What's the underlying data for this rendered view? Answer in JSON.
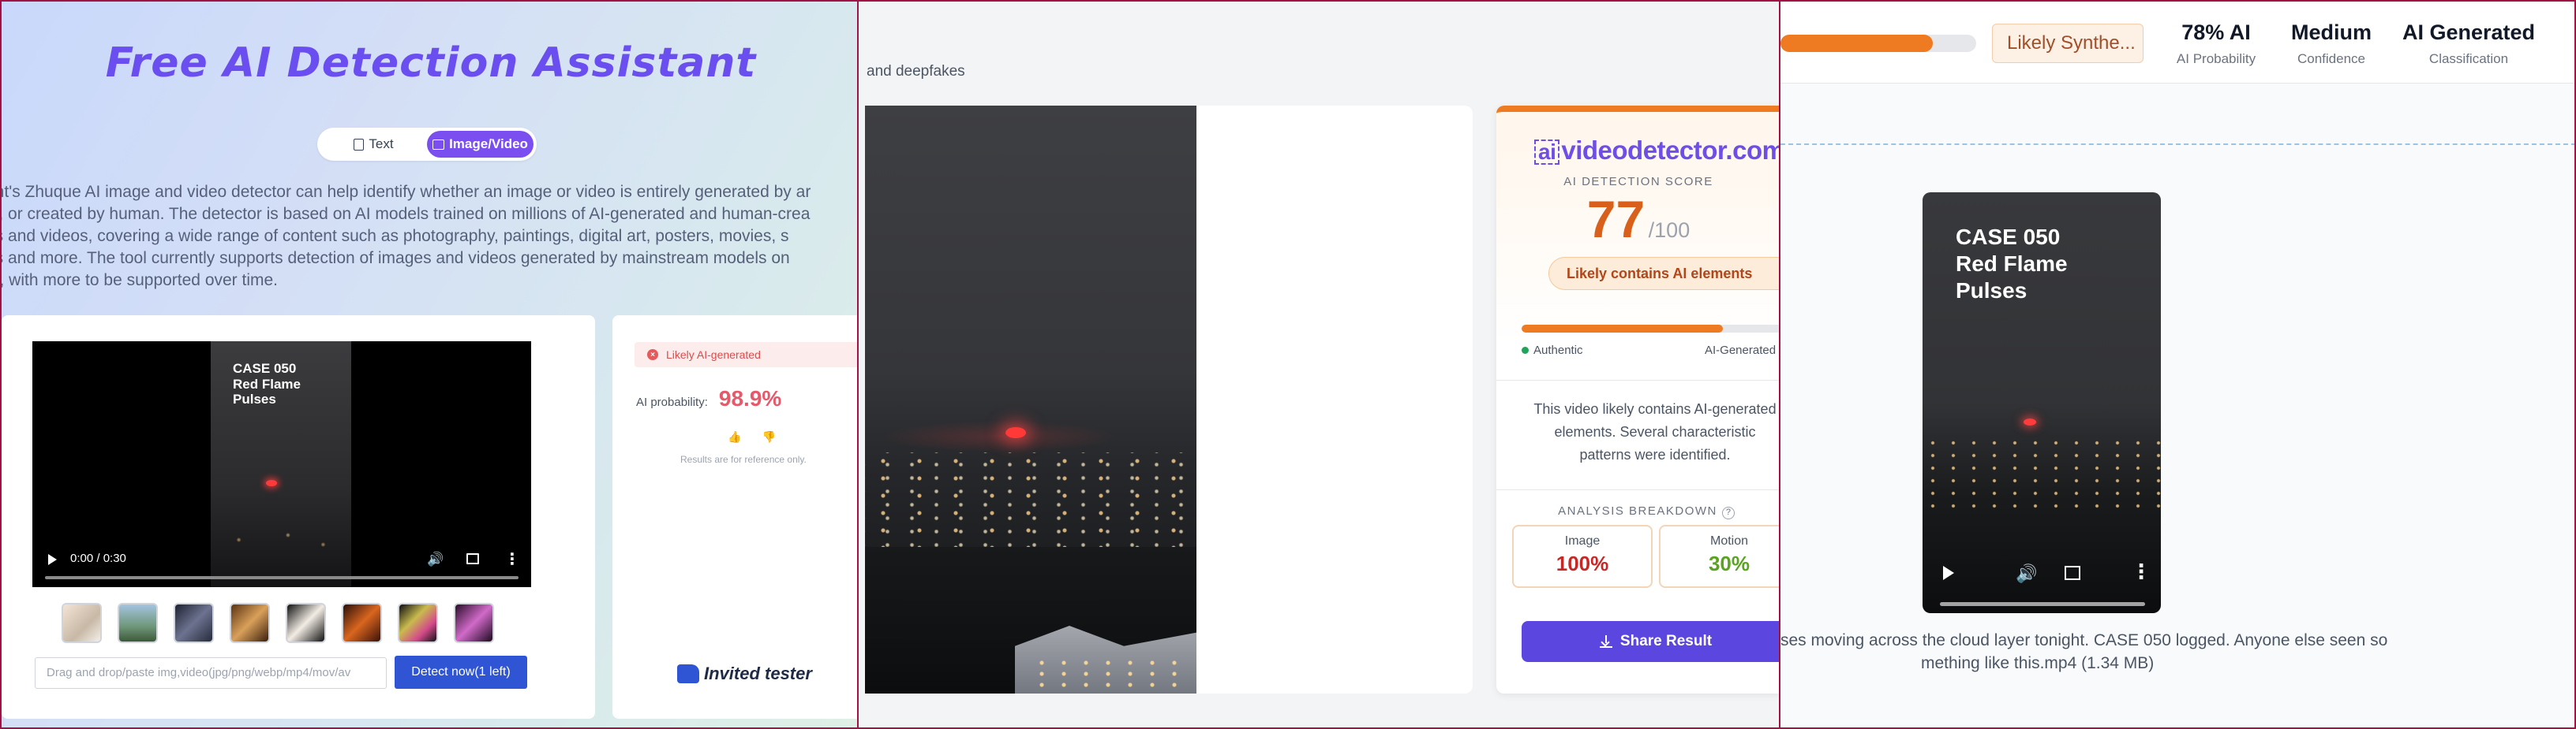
{
  "panel1": {
    "title": "Free AI Detection Assistant",
    "tabs": [
      {
        "label": "Text",
        "active": false
      },
      {
        "label": "Image/Video",
        "active": true
      }
    ],
    "description_lines": [
      "ent's Zhuque AI image and video detector can help identify whether an image or video is entirely generated by ar",
      "el, or created by human. The detector is based on AI models trained on millions of AI-generated and human-crea",
      "es and videos, covering a wide range of content such as photography, paintings, digital art, posters, movies, s",
      "os and more. The tool currently supports detection of images and videos generated by mainstream models on",
      "et, with more to be supported over time."
    ],
    "video": {
      "overlay_lines": [
        "CASE 050",
        "Red Flame",
        "Pulses"
      ],
      "time": "0:00 / 0:30"
    },
    "upload_placeholder": "Drag and drop/paste img,video(jpg/png/webp/mp4/mov/av",
    "detect_button": "Detect now(1 left)",
    "result": {
      "badge": "Likely AI-generated",
      "prob_label": "AI probability:",
      "prob_value": "98.9%",
      "note": "Results are for reference only."
    },
    "tester_label": "Invited tester",
    "colors": {
      "accent": "#7b4ef0",
      "detect": "#2f55d4",
      "prob": "#e5596b"
    }
  },
  "panel2": {
    "top_text": "and deepfakes",
    "brand": {
      "prefix": "ai",
      "name": "videodetector.com"
    },
    "score_label": "AI DETECTION SCORE",
    "score": "77",
    "score_max": "/100",
    "verdict": "Likely contains AI elements",
    "meter_fraction": 0.75,
    "meter_left": "Authentic",
    "meter_right": "AI-Generated",
    "summary_lines": [
      "This video likely contains AI-generated",
      "elements. Several characteristic",
      "patterns were identified."
    ],
    "breakdown_label": "ANALYSIS BREAKDOWN",
    "metrics": [
      {
        "label": "Image",
        "value": "100%",
        "color": "#c62828"
      },
      {
        "label": "Motion",
        "value": "30%",
        "color": "#5aa321"
      }
    ],
    "share_button": "Share Result",
    "colors": {
      "accent": "#ee7b22",
      "score": "#d9601a",
      "share": "#5b47e0"
    }
  },
  "panel3": {
    "progress_fraction": 0.78,
    "verdict_pill": "Likely Synthe...",
    "stats": [
      {
        "value": "78% AI",
        "label": "AI Probability"
      },
      {
        "value": "Medium",
        "label": "Confidence"
      },
      {
        "value": "AI Generated",
        "label": "Classification"
      }
    ],
    "video": {
      "overlay_lines": [
        "CASE 050",
        "Red Flame",
        "Pulses"
      ]
    },
    "caption_lines": [
      "ses moving across the cloud layer tonight. CASE 050 logged. Anyone else seen so",
      "mething like this.mp4 (1.34 MB)"
    ]
  }
}
